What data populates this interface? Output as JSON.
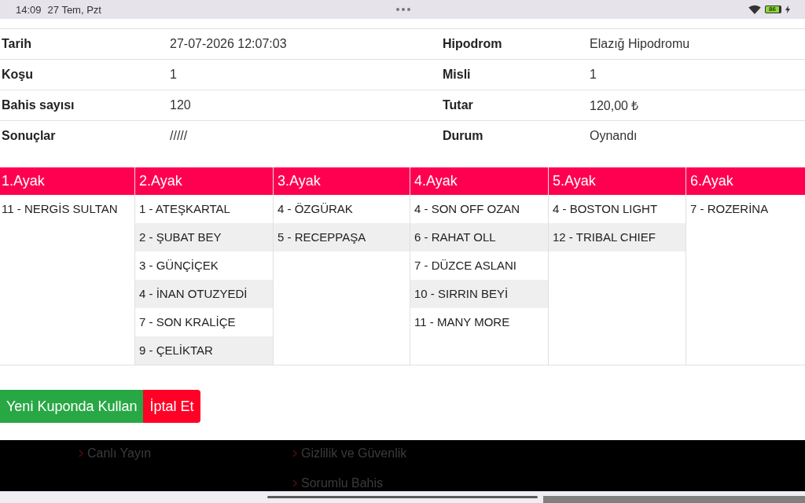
{
  "status_bar": {
    "time": "14:09",
    "date": "27 Tem, Pzt",
    "battery": "86"
  },
  "details": {
    "rows": [
      {
        "left": {
          "label": "Tarih",
          "value": "27-07-2026 12:07:03"
        },
        "right": {
          "label": "Hipodrom",
          "value": "Elazığ Hipodromu"
        }
      },
      {
        "left": {
          "label": "Koşu",
          "value": "1"
        },
        "right": {
          "label": "Misli",
          "value": "1"
        }
      },
      {
        "left": {
          "label": "Bahis sayısı",
          "value": "120"
        },
        "right": {
          "label": "Tutar",
          "value": "120,00 ₺"
        }
      },
      {
        "left": {
          "label": "Sonuçlar",
          "value": "/////"
        },
        "right": {
          "label": "Durum",
          "value": "Oynandı"
        }
      }
    ]
  },
  "legs": [
    {
      "title": "1.Ayak",
      "horses": [
        "11 - NERGİS SULTAN"
      ]
    },
    {
      "title": "2.Ayak",
      "horses": [
        "1 - ATEŞKARTAL",
        "2 - ŞUBAT BEY",
        "3 - GÜNÇİÇEK",
        "4 - İNAN OTUZYEDİ",
        "7 - SON KRALİÇE",
        "9 - ÇELİKTAR"
      ]
    },
    {
      "title": "3.Ayak",
      "horses": [
        "4 - ÖZGÜRAK",
        "5 - RECEPPAŞA"
      ]
    },
    {
      "title": "4.Ayak",
      "horses": [
        "4 - SON OFF OZAN",
        "6 - RAHAT OLL",
        "7 - DÜZCE ASLANI",
        "10 - SIRRIN BEYİ",
        "11 - MANY MORE"
      ]
    },
    {
      "title": "5.Ayak",
      "horses": [
        "4 - BOSTON LIGHT",
        "12 - TRIBAL CHIEF"
      ]
    },
    {
      "title": "6.Ayak",
      "horses": [
        "7 - ROZERİNA"
      ]
    }
  ],
  "actions": [
    {
      "label": "Yeni Kuponda Kullan",
      "kind": "success"
    },
    {
      "label": "İptal Et",
      "kind": "danger"
    }
  ],
  "footer": {
    "columns": [
      {
        "links": [
          "Canlı Yayın"
        ]
      },
      {
        "links": [
          "Gizlilik ve Güvenlik",
          "Sorumlu Bahis"
        ]
      }
    ]
  }
}
